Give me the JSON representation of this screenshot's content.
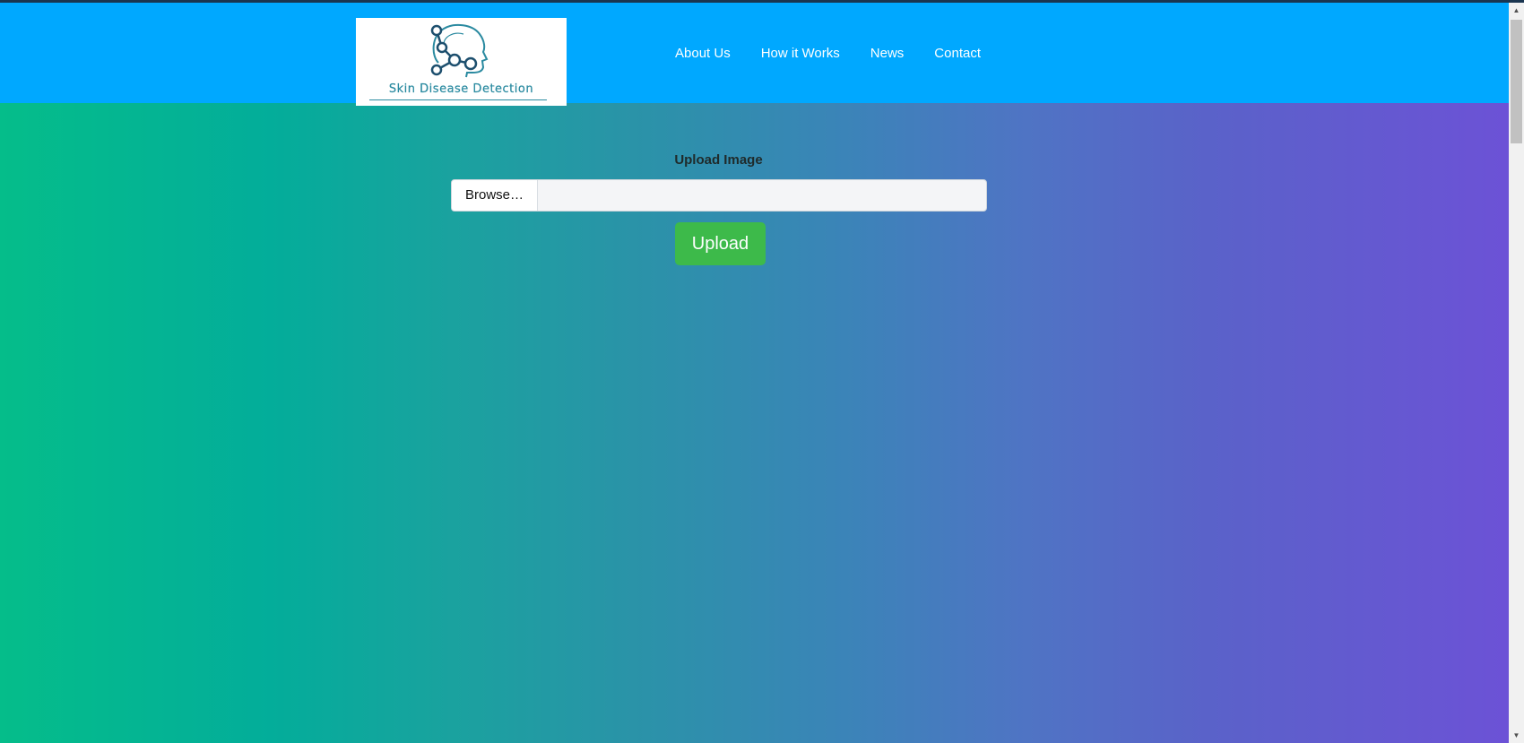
{
  "logo": {
    "text": "Skin Disease Detection",
    "icon": "head-molecule-icon"
  },
  "nav": {
    "items": [
      {
        "label": "About Us"
      },
      {
        "label": "How it Works"
      },
      {
        "label": "News"
      },
      {
        "label": "Contact"
      }
    ]
  },
  "upload": {
    "label": "Upload Image",
    "browse_label": "Browse…",
    "file_name": "",
    "button_label": "Upload"
  },
  "colors": {
    "navbar": "#00a8ff",
    "upload_button": "#3dba4a",
    "gradient_start": "#05bd8a",
    "gradient_end": "#6c52d6"
  },
  "scrollbar": {
    "up_icon": "arrow-up-icon",
    "down_icon": "arrow-down-icon"
  }
}
